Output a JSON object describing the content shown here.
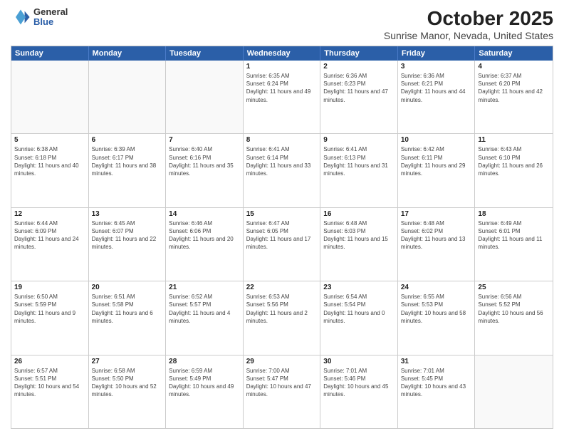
{
  "logo": {
    "general": "General",
    "blue": "Blue"
  },
  "title": "October 2025",
  "subtitle": "Sunrise Manor, Nevada, United States",
  "headers": [
    "Sunday",
    "Monday",
    "Tuesday",
    "Wednesday",
    "Thursday",
    "Friday",
    "Saturday"
  ],
  "rows": [
    [
      {
        "day": "",
        "info": ""
      },
      {
        "day": "",
        "info": ""
      },
      {
        "day": "",
        "info": ""
      },
      {
        "day": "1",
        "info": "Sunrise: 6:35 AM\nSunset: 6:24 PM\nDaylight: 11 hours and 49 minutes."
      },
      {
        "day": "2",
        "info": "Sunrise: 6:36 AM\nSunset: 6:23 PM\nDaylight: 11 hours and 47 minutes."
      },
      {
        "day": "3",
        "info": "Sunrise: 6:36 AM\nSunset: 6:21 PM\nDaylight: 11 hours and 44 minutes."
      },
      {
        "day": "4",
        "info": "Sunrise: 6:37 AM\nSunset: 6:20 PM\nDaylight: 11 hours and 42 minutes."
      }
    ],
    [
      {
        "day": "5",
        "info": "Sunrise: 6:38 AM\nSunset: 6:18 PM\nDaylight: 11 hours and 40 minutes."
      },
      {
        "day": "6",
        "info": "Sunrise: 6:39 AM\nSunset: 6:17 PM\nDaylight: 11 hours and 38 minutes."
      },
      {
        "day": "7",
        "info": "Sunrise: 6:40 AM\nSunset: 6:16 PM\nDaylight: 11 hours and 35 minutes."
      },
      {
        "day": "8",
        "info": "Sunrise: 6:41 AM\nSunset: 6:14 PM\nDaylight: 11 hours and 33 minutes."
      },
      {
        "day": "9",
        "info": "Sunrise: 6:41 AM\nSunset: 6:13 PM\nDaylight: 11 hours and 31 minutes."
      },
      {
        "day": "10",
        "info": "Sunrise: 6:42 AM\nSunset: 6:11 PM\nDaylight: 11 hours and 29 minutes."
      },
      {
        "day": "11",
        "info": "Sunrise: 6:43 AM\nSunset: 6:10 PM\nDaylight: 11 hours and 26 minutes."
      }
    ],
    [
      {
        "day": "12",
        "info": "Sunrise: 6:44 AM\nSunset: 6:09 PM\nDaylight: 11 hours and 24 minutes."
      },
      {
        "day": "13",
        "info": "Sunrise: 6:45 AM\nSunset: 6:07 PM\nDaylight: 11 hours and 22 minutes."
      },
      {
        "day": "14",
        "info": "Sunrise: 6:46 AM\nSunset: 6:06 PM\nDaylight: 11 hours and 20 minutes."
      },
      {
        "day": "15",
        "info": "Sunrise: 6:47 AM\nSunset: 6:05 PM\nDaylight: 11 hours and 17 minutes."
      },
      {
        "day": "16",
        "info": "Sunrise: 6:48 AM\nSunset: 6:03 PM\nDaylight: 11 hours and 15 minutes."
      },
      {
        "day": "17",
        "info": "Sunrise: 6:48 AM\nSunset: 6:02 PM\nDaylight: 11 hours and 13 minutes."
      },
      {
        "day": "18",
        "info": "Sunrise: 6:49 AM\nSunset: 6:01 PM\nDaylight: 11 hours and 11 minutes."
      }
    ],
    [
      {
        "day": "19",
        "info": "Sunrise: 6:50 AM\nSunset: 5:59 PM\nDaylight: 11 hours and 9 minutes."
      },
      {
        "day": "20",
        "info": "Sunrise: 6:51 AM\nSunset: 5:58 PM\nDaylight: 11 hours and 6 minutes."
      },
      {
        "day": "21",
        "info": "Sunrise: 6:52 AM\nSunset: 5:57 PM\nDaylight: 11 hours and 4 minutes."
      },
      {
        "day": "22",
        "info": "Sunrise: 6:53 AM\nSunset: 5:56 PM\nDaylight: 11 hours and 2 minutes."
      },
      {
        "day": "23",
        "info": "Sunrise: 6:54 AM\nSunset: 5:54 PM\nDaylight: 11 hours and 0 minutes."
      },
      {
        "day": "24",
        "info": "Sunrise: 6:55 AM\nSunset: 5:53 PM\nDaylight: 10 hours and 58 minutes."
      },
      {
        "day": "25",
        "info": "Sunrise: 6:56 AM\nSunset: 5:52 PM\nDaylight: 10 hours and 56 minutes."
      }
    ],
    [
      {
        "day": "26",
        "info": "Sunrise: 6:57 AM\nSunset: 5:51 PM\nDaylight: 10 hours and 54 minutes."
      },
      {
        "day": "27",
        "info": "Sunrise: 6:58 AM\nSunset: 5:50 PM\nDaylight: 10 hours and 52 minutes."
      },
      {
        "day": "28",
        "info": "Sunrise: 6:59 AM\nSunset: 5:49 PM\nDaylight: 10 hours and 49 minutes."
      },
      {
        "day": "29",
        "info": "Sunrise: 7:00 AM\nSunset: 5:47 PM\nDaylight: 10 hours and 47 minutes."
      },
      {
        "day": "30",
        "info": "Sunrise: 7:01 AM\nSunset: 5:46 PM\nDaylight: 10 hours and 45 minutes."
      },
      {
        "day": "31",
        "info": "Sunrise: 7:01 AM\nSunset: 5:45 PM\nDaylight: 10 hours and 43 minutes."
      },
      {
        "day": "",
        "info": ""
      }
    ]
  ]
}
